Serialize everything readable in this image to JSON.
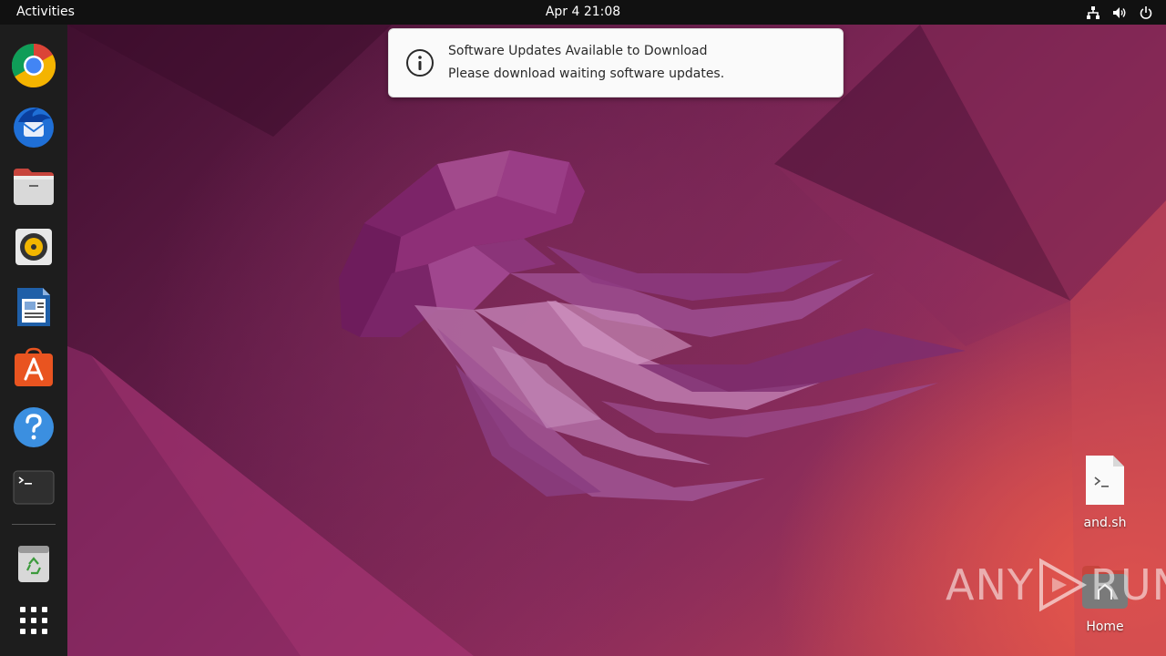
{
  "topbar": {
    "activities_label": "Activities",
    "clock": "Apr 4  21:08",
    "tray_icons": [
      "network-icon",
      "volume-icon",
      "power-icon"
    ]
  },
  "dock": {
    "items": [
      {
        "name": "chrome",
        "icon": "chrome-icon"
      },
      {
        "name": "thunderbird",
        "icon": "thunderbird-icon"
      },
      {
        "name": "files",
        "icon": "files-icon"
      },
      {
        "name": "rhythmbox",
        "icon": "rhythmbox-icon"
      },
      {
        "name": "libreoffice-writer",
        "icon": "writer-icon"
      },
      {
        "name": "software",
        "icon": "software-icon"
      },
      {
        "name": "help",
        "icon": "help-icon"
      },
      {
        "name": "terminal",
        "icon": "terminal-icon"
      },
      {
        "name": "trash",
        "icon": "trash-icon"
      },
      {
        "name": "show-apps",
        "icon": "app-grid-icon"
      }
    ]
  },
  "notification": {
    "title": "Software Updates Available to Download",
    "body": "Please download waiting software updates.",
    "icon": "info-icon"
  },
  "desktop": {
    "icons": [
      {
        "label": "and.sh",
        "icon": "script-file-icon"
      },
      {
        "label": "Home",
        "icon": "home-folder-icon"
      }
    ]
  },
  "watermark": {
    "text_left": "ANY",
    "text_right": "RUN"
  },
  "colors": {
    "topbar": "#111111",
    "dock": "#1d1d1d",
    "wallpaper_dark": "#3a0d2b",
    "wallpaper_accent": "#e8574a"
  }
}
